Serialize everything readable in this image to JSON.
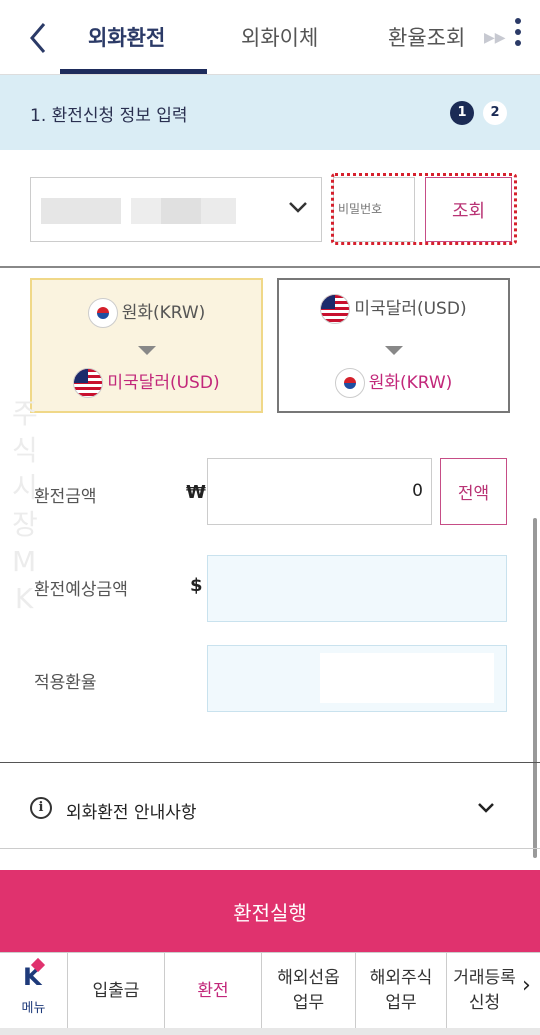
{
  "header": {
    "tabs": [
      {
        "label": "외화환전",
        "active": true
      },
      {
        "label": "외화이체",
        "active": false
      },
      {
        "label": "환율조회",
        "active": false
      }
    ]
  },
  "step": {
    "title": "1. 환전신청 정보 입력",
    "steps": [
      "1",
      "2"
    ],
    "current": 1
  },
  "account": {
    "password_placeholder": "비밀번호",
    "inquiry_label": "조회"
  },
  "direction": {
    "option1": {
      "from": "원화(KRW)",
      "to": "미국달러(USD)",
      "selected": true
    },
    "option2": {
      "from": "미국달러(USD)",
      "to": "원화(KRW)",
      "selected": false
    }
  },
  "form": {
    "amount_label": "환전금액",
    "amount_symbol": "₩",
    "amount_value": "0",
    "all_label": "전액",
    "expected_label": "환전예상금액",
    "expected_symbol": "$",
    "rate_label": "적용환율"
  },
  "watermark": [
    "주",
    "식",
    "시",
    "장",
    "M",
    "K"
  ],
  "notice": {
    "label": "외화환전 안내사항"
  },
  "execute_label": "환전실행",
  "bottom_nav": {
    "menu_label": "메뉴",
    "items": [
      {
        "label": "입출금",
        "active": false
      },
      {
        "label": "환전",
        "active": true
      },
      {
        "label": "해외선옵\n업무",
        "active": false
      },
      {
        "label": "해외주식\n업무",
        "active": false
      },
      {
        "label": "거래등록\n신청",
        "active": false
      }
    ]
  },
  "colors": {
    "primary": "#e0326e",
    "navy": "#1e2c5c",
    "highlight": "#c2277a"
  }
}
